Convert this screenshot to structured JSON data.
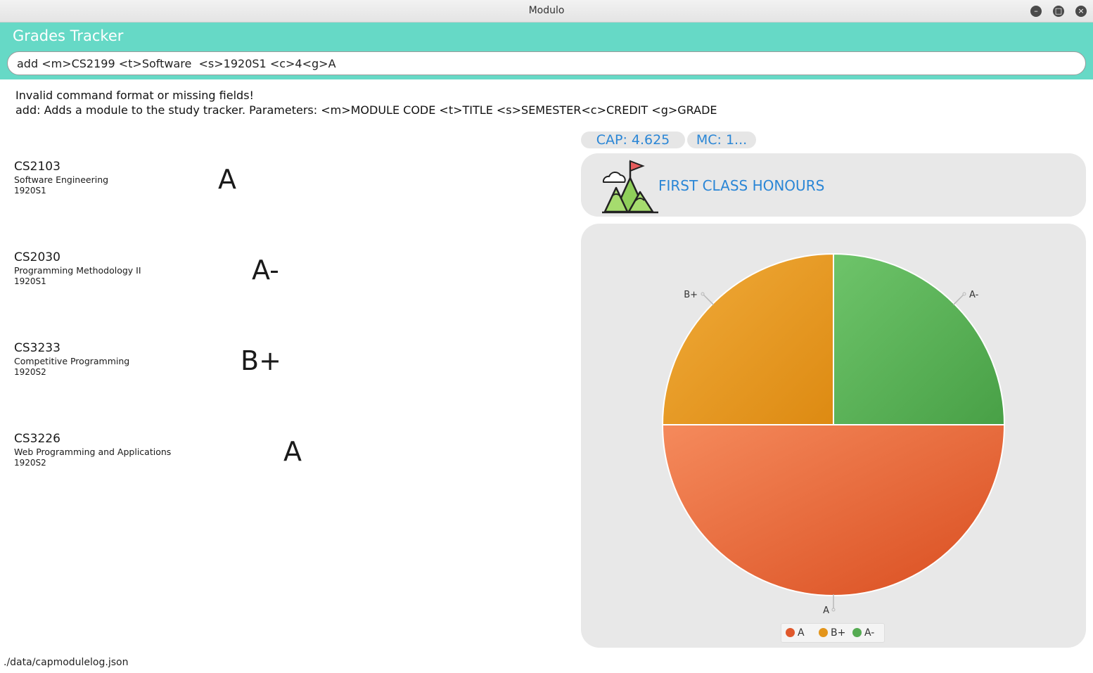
{
  "window": {
    "title": "Modulo"
  },
  "header": {
    "title": "Grades Tracker"
  },
  "command": {
    "value": "add <m>CS2199 <t>Software  <s>1920S1 <c>4<g>A"
  },
  "result": {
    "line1": "Invalid command format or missing fields!",
    "line2": "add: Adds a module to the study tracker. Parameters: <m>MODULE CODE <t>TITLE <s>SEMESTER<c>CREDIT <g>GRADE"
  },
  "modules": [
    {
      "code": "CS2103",
      "title": "Software Engineering",
      "semester": "1920S1",
      "grade": "A"
    },
    {
      "code": "CS2030",
      "title": "Programming Methodology II",
      "semester": "1920S1",
      "grade": "A-"
    },
    {
      "code": "CS3233",
      "title": "Competitive Programming",
      "semester": "1920S2",
      "grade": "B+"
    },
    {
      "code": "CS3226",
      "title": "Web Programming and Applications",
      "semester": "1920S2",
      "grade": "A"
    }
  ],
  "stats": {
    "cap": "CAP: 4.625",
    "mc": "MC: 1..."
  },
  "honours": {
    "label": "FIRST CLASS HONOURS",
    "icon": "mountain-flag-icon"
  },
  "chart_data": {
    "type": "pie",
    "categories": [
      "A",
      "B+",
      "A-"
    ],
    "values": [
      2,
      1,
      1
    ],
    "colors": [
      "#e0582c",
      "#e3951b",
      "#55ab52"
    ],
    "legend": "bottom"
  },
  "status": {
    "file": "./data/capmodulelog.json"
  }
}
